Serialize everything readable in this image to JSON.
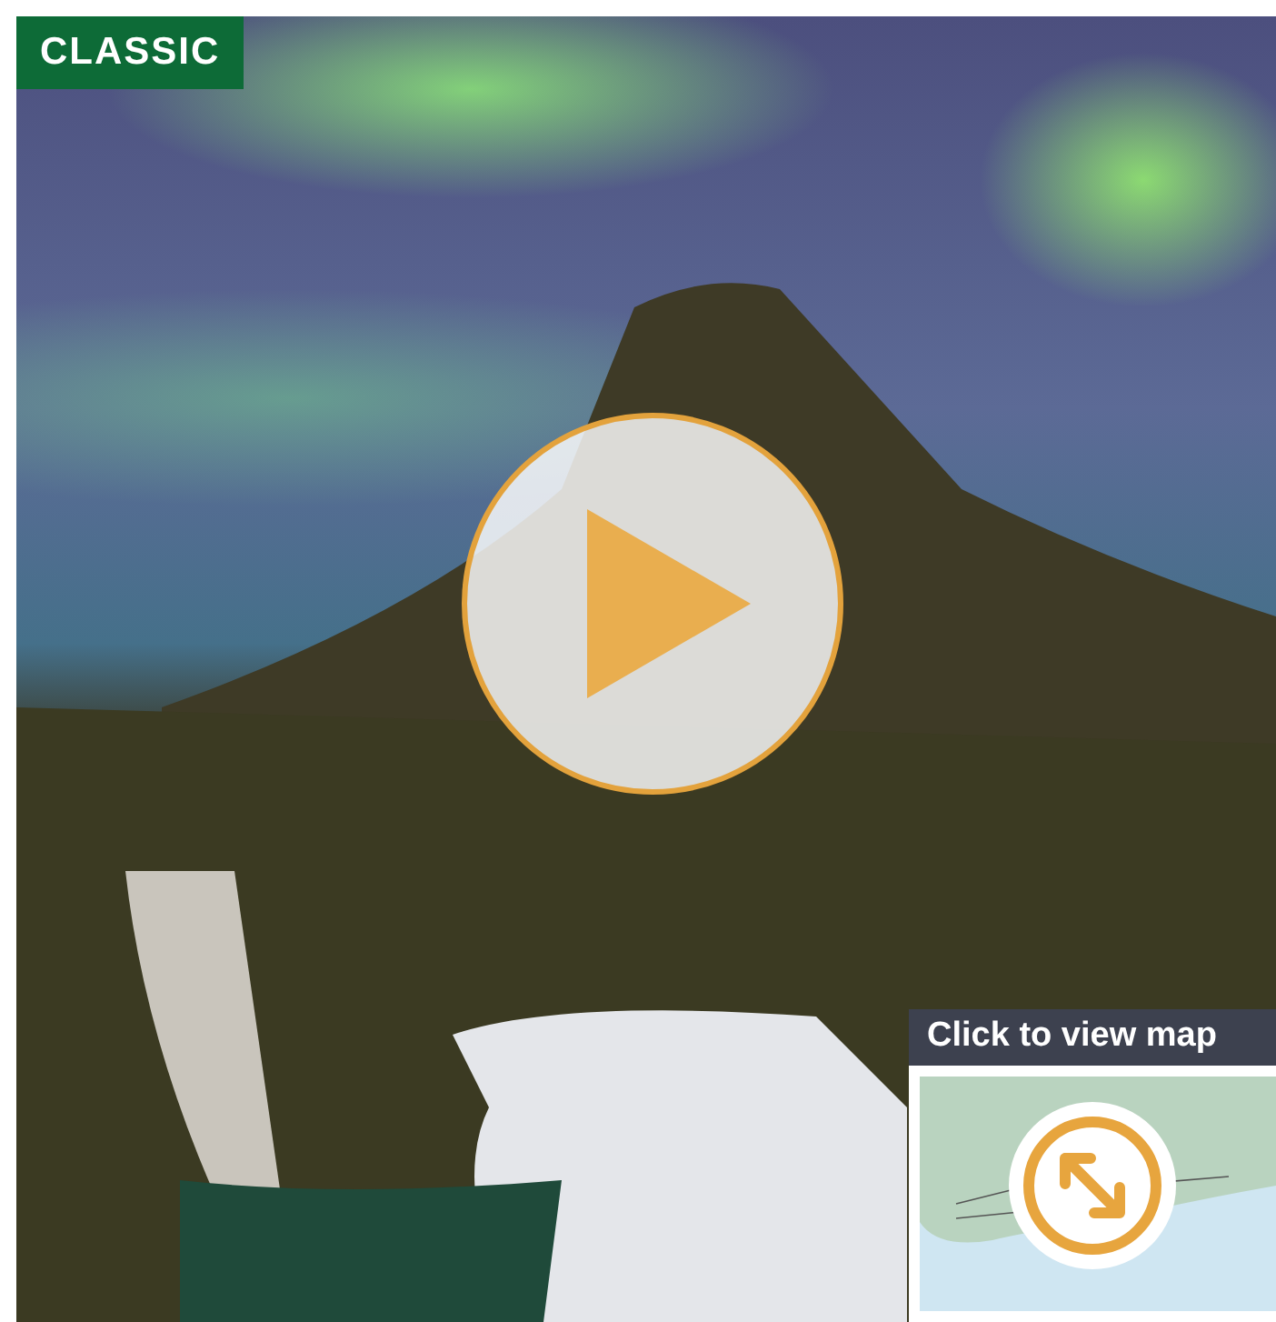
{
  "badge": {
    "label": "CLASSIC"
  },
  "video": {
    "kind": "play"
  },
  "map_preview": {
    "label": "Click to view map"
  }
}
